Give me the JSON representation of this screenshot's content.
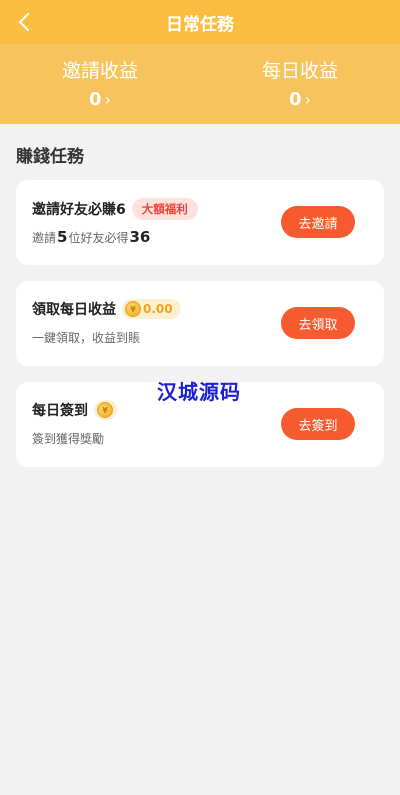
{
  "header": {
    "title": "日常任務"
  },
  "earnings": [
    {
      "label": "邀請收益",
      "value": "0"
    },
    {
      "label": "每日收益",
      "value": "0"
    }
  ],
  "section": {
    "title": "賺錢任務"
  },
  "tasks": {
    "invite": {
      "title": "邀請好友必賺6",
      "badge": "大額福利",
      "sub_pre": "邀請",
      "sub_num1": "5",
      "sub_mid": "位好友必得",
      "sub_num2": "36",
      "button": "去邀請"
    },
    "daily": {
      "title": "領取每日收益",
      "coin_symbol": "¥",
      "amount": "0.00",
      "sub": "一鍵領取，收益到賬",
      "button": "去領取"
    },
    "signin": {
      "title": "每日簽到",
      "coin_symbol": "¥",
      "sub": "簽到獲得獎勵",
      "button": "去簽到"
    }
  },
  "watermark": "汉城源码",
  "colors": {
    "header": "#fbbd3f",
    "earnings_bg": "#f6c35d",
    "button": "#f55b2e",
    "badge_bg": "#fde1dd",
    "badge_text": "#e8453c"
  }
}
